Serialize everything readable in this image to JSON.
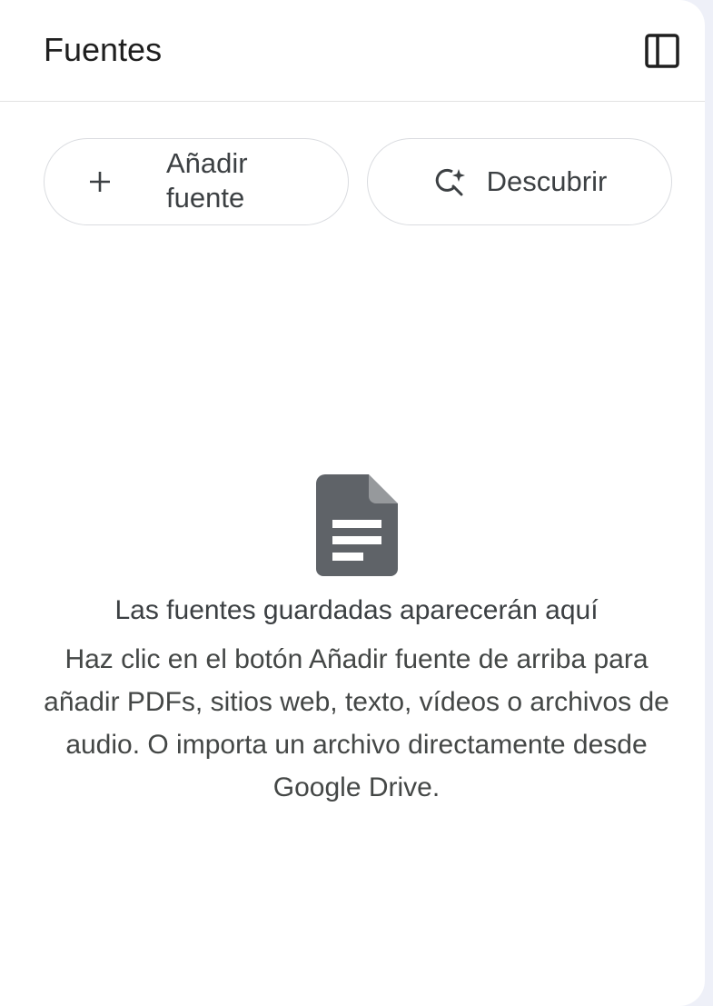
{
  "header": {
    "title": "Fuentes",
    "toggle_icon": "side-panel-icon"
  },
  "actions": {
    "add_source": {
      "label_line1": "Añadir",
      "label_line2": "fuente",
      "icon": "plus-icon"
    },
    "discover": {
      "label": "Descubrir",
      "icon": "search-sparkle-icon"
    }
  },
  "empty_state": {
    "icon": "document-icon",
    "title": "Las fuentes guardadas aparecerán aquí",
    "description": "Haz clic en el botón Añadir fuente de arriba para añadir PDFs, sitios web, texto, vídeos o archivos de audio. O importa un archivo directamente desde Google Drive."
  },
  "colors": {
    "background": "#eef0f8",
    "panel": "#ffffff",
    "border": "#dadce0",
    "icon": "#5f6368"
  }
}
